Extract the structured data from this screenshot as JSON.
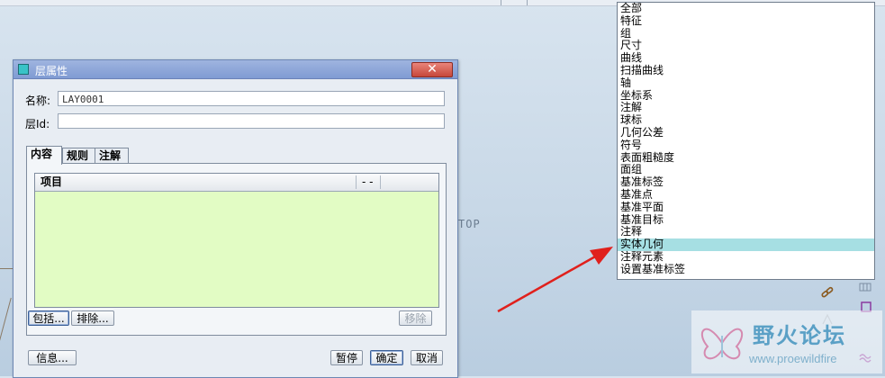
{
  "canvas": {
    "view_label": "TOP"
  },
  "dialog": {
    "title": "层属性",
    "close_label": "✕",
    "name_label": "名称:",
    "name_value": "LAY0001",
    "id_label": "层Id:",
    "id_value": "",
    "tabs": [
      {
        "label": "内容",
        "active": true
      },
      {
        "label": "规则",
        "active": false
      },
      {
        "label": "注解",
        "active": false
      }
    ],
    "list": {
      "columns": [
        "项目",
        "- -"
      ],
      "rows": []
    },
    "include_label": "包括...",
    "exclude_label": "排除...",
    "remove_label": "移除",
    "info_label": "信息...",
    "pause_label": "暂停",
    "ok_label": "确定",
    "cancel_label": "取消"
  },
  "dropdown": {
    "items": [
      "全部",
      "特征",
      "组",
      "尺寸",
      "曲线",
      "扫描曲线",
      "轴",
      "坐标系",
      "注解",
      "球标",
      "几何公差",
      "符号",
      "表面粗糙度",
      "面组",
      "基准标签",
      "基准点",
      "基准平面",
      "基准目标",
      "注释",
      "实体几何",
      "注释元素",
      "设置基准标签"
    ],
    "selected": "实体几何"
  },
  "watermark": {
    "title": "野火论坛",
    "url": "www.proewildfire"
  },
  "colors": {
    "arrow": "#e0201c",
    "selection": "#a6dfe3",
    "list_bg": "#e2fcc4",
    "titlebar": "#7f9bd3"
  }
}
